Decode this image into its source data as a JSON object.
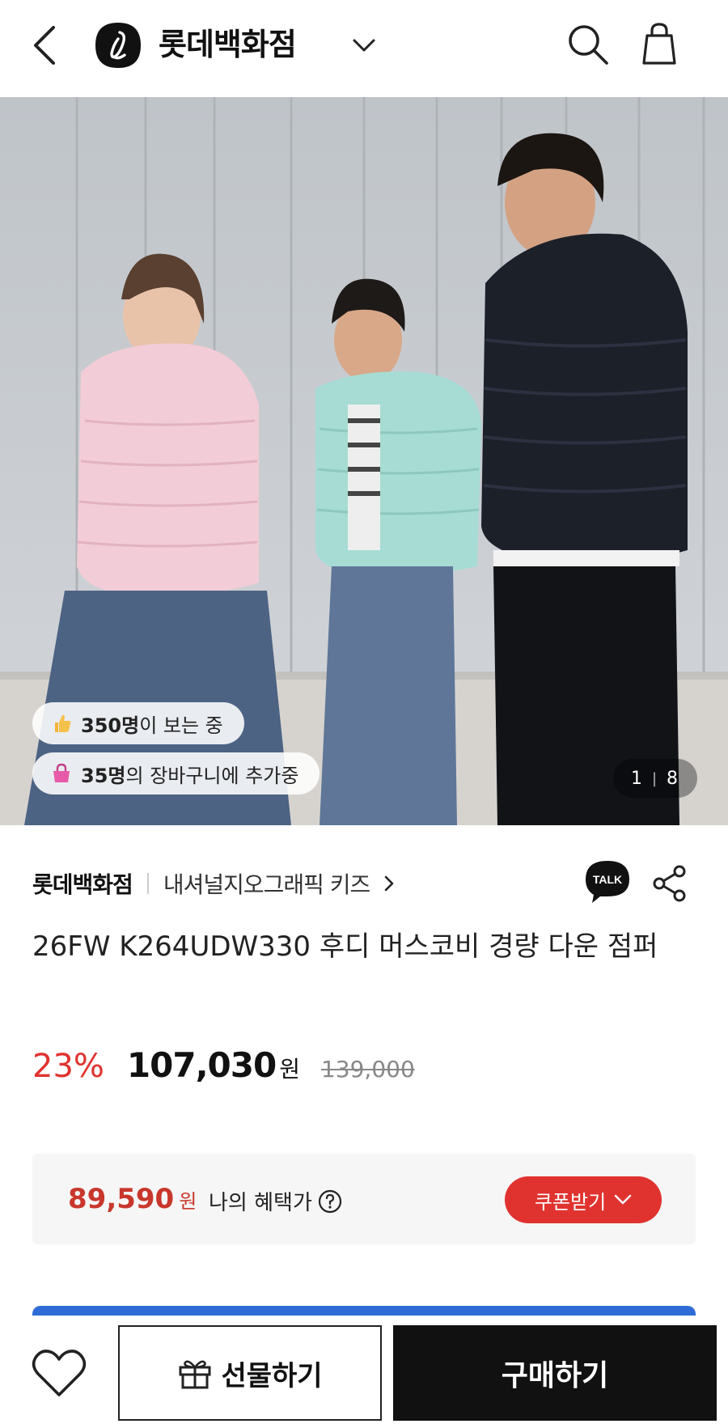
{
  "header": {
    "title": "롯데백화점",
    "icons": [
      "back-icon",
      "lotte-logo",
      "chevron-down-icon",
      "search-icon",
      "shopping-bag-icon"
    ]
  },
  "hero": {
    "views_count": "350명",
    "views_suffix": "이 보는 중",
    "cart_count": "35명",
    "cart_suffix": "의 장바구니에 추가중",
    "page_current": "1",
    "page_total": "8"
  },
  "product": {
    "store": "롯데백화점",
    "brand": "내셔널지오그래픽 키즈",
    "talk_label": "TALK",
    "name": "26FW K264UDW330 후디 머스코비 경량 다운 점퍼",
    "discount": "23%",
    "price": "107,030",
    "price_unit": "원",
    "original_price": "139,000"
  },
  "benefit": {
    "price": "89,590",
    "unit": "원",
    "label": "나의 혜택가",
    "coupon_label": "쿠폰받기"
  },
  "actions": {
    "gift_label": "선물하기",
    "buy_label": "구매하기"
  },
  "colors": {
    "accent_red": "#e0332f",
    "blue_bar": "#2f6bd6",
    "buy_black": "#111111"
  }
}
